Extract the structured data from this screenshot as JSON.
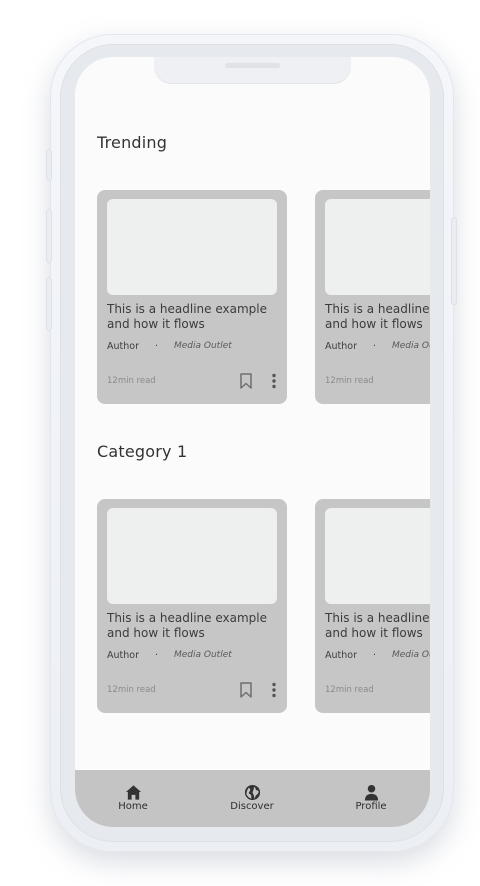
{
  "sections": [
    {
      "title": "Trending",
      "cards": [
        {
          "headline": "This is a headline example and how it flows",
          "author": "Author",
          "separator": "·",
          "outlet": "Media Outlet",
          "read_time": "12min read"
        },
        {
          "headline": "This is a headline example and how it flows",
          "author": "Author",
          "separator": "·",
          "outlet": "Media Outlet",
          "read_time": "12min read"
        }
      ]
    },
    {
      "title": "Category 1",
      "cards": [
        {
          "headline": "This is a headline example and how it flows",
          "author": "Author",
          "separator": "·",
          "outlet": "Media Outlet",
          "read_time": "12min read"
        },
        {
          "headline": "This is a headline example and how it flows",
          "author": "Author",
          "separator": "·",
          "outlet": "Media Outlet",
          "read_time": "12min read"
        }
      ]
    }
  ],
  "tabbar": {
    "items": [
      {
        "label": "Home",
        "icon": "home-icon"
      },
      {
        "label": "Discover",
        "icon": "globe-icon"
      },
      {
        "label": "Profile",
        "icon": "person-icon"
      }
    ]
  },
  "colors": {
    "card_background": "#c6c6c6",
    "thumbnail": "#eeefef",
    "tabbar_background": "#c4c4c4",
    "screen_background": "#fbfbfb"
  }
}
